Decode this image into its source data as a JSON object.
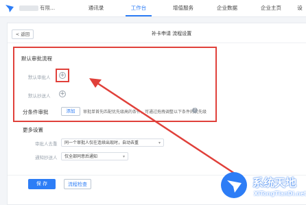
{
  "topbar": {
    "company": "有限...",
    "nav": [
      "通讯录",
      "工作台",
      "增值服务",
      "企业数据",
      "企业主页",
      "设"
    ],
    "active_index": 1
  },
  "page": {
    "back_label": "< 返回",
    "title": "补卡申请 流程设置"
  },
  "default_flow": {
    "title": "默认审批流程",
    "approver_label": "默认审批人",
    "cc_label": "默认抄送人"
  },
  "branch": {
    "title": "分条件审批",
    "add_label": "添加",
    "hint": "审批单首先匹配优先级高的条件，可通过拖拽调整以下条件的优先级"
  },
  "more": {
    "title": "更多设置",
    "dedupe_label": "审批人去重",
    "dedupe_value": "同一个审批人仅在连续出现时，自动去重",
    "notify_label": "通知抄送人",
    "notify_value": "仅全部同意后通知"
  },
  "actions": {
    "save_label": "保 存",
    "preview_label": "流程检查"
  },
  "watermark": {
    "big": "系统天地",
    "small": "XiTongTianDi.net"
  },
  "colors": {
    "accent": "#2d7df6",
    "highlight": "#e0403a"
  }
}
